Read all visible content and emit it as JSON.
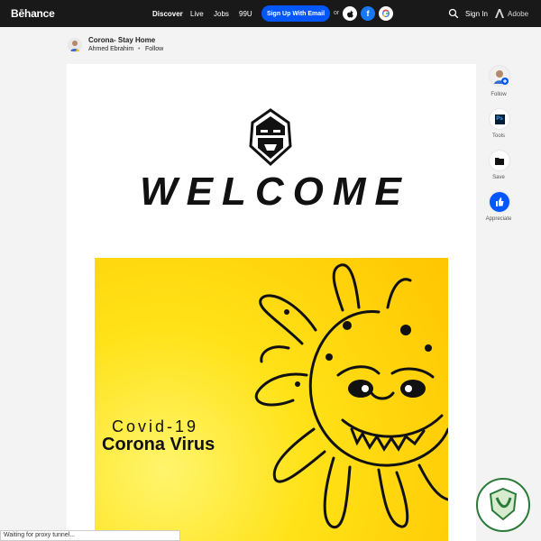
{
  "topbar": {
    "logo": "Bēhance",
    "nav": [
      "Discover",
      "Live",
      "Jobs",
      "99U"
    ],
    "signup_label": "Sign Up With Email",
    "or_label": "or",
    "signin_label": "Sign In",
    "adobe_label": "Adobe"
  },
  "project": {
    "title": "Corona- Stay Home",
    "owner": "Ahmed Ebrahim",
    "follow_label": "Follow"
  },
  "content": {
    "welcome": "WELCOME",
    "covid_label": "Covid-19",
    "corona_label": "Corona Virus"
  },
  "sidebar": {
    "follow_label": "Follow",
    "tools_label": "Tools",
    "tools_icon_text": "Ps",
    "save_label": "Save",
    "appreciate_label": "Appreciate"
  },
  "status": {
    "text": "Waiting for proxy tunnel..."
  },
  "colors": {
    "accent": "#0057ff",
    "topbar_bg": "#191919",
    "hero_yellow": "#ffd400"
  }
}
